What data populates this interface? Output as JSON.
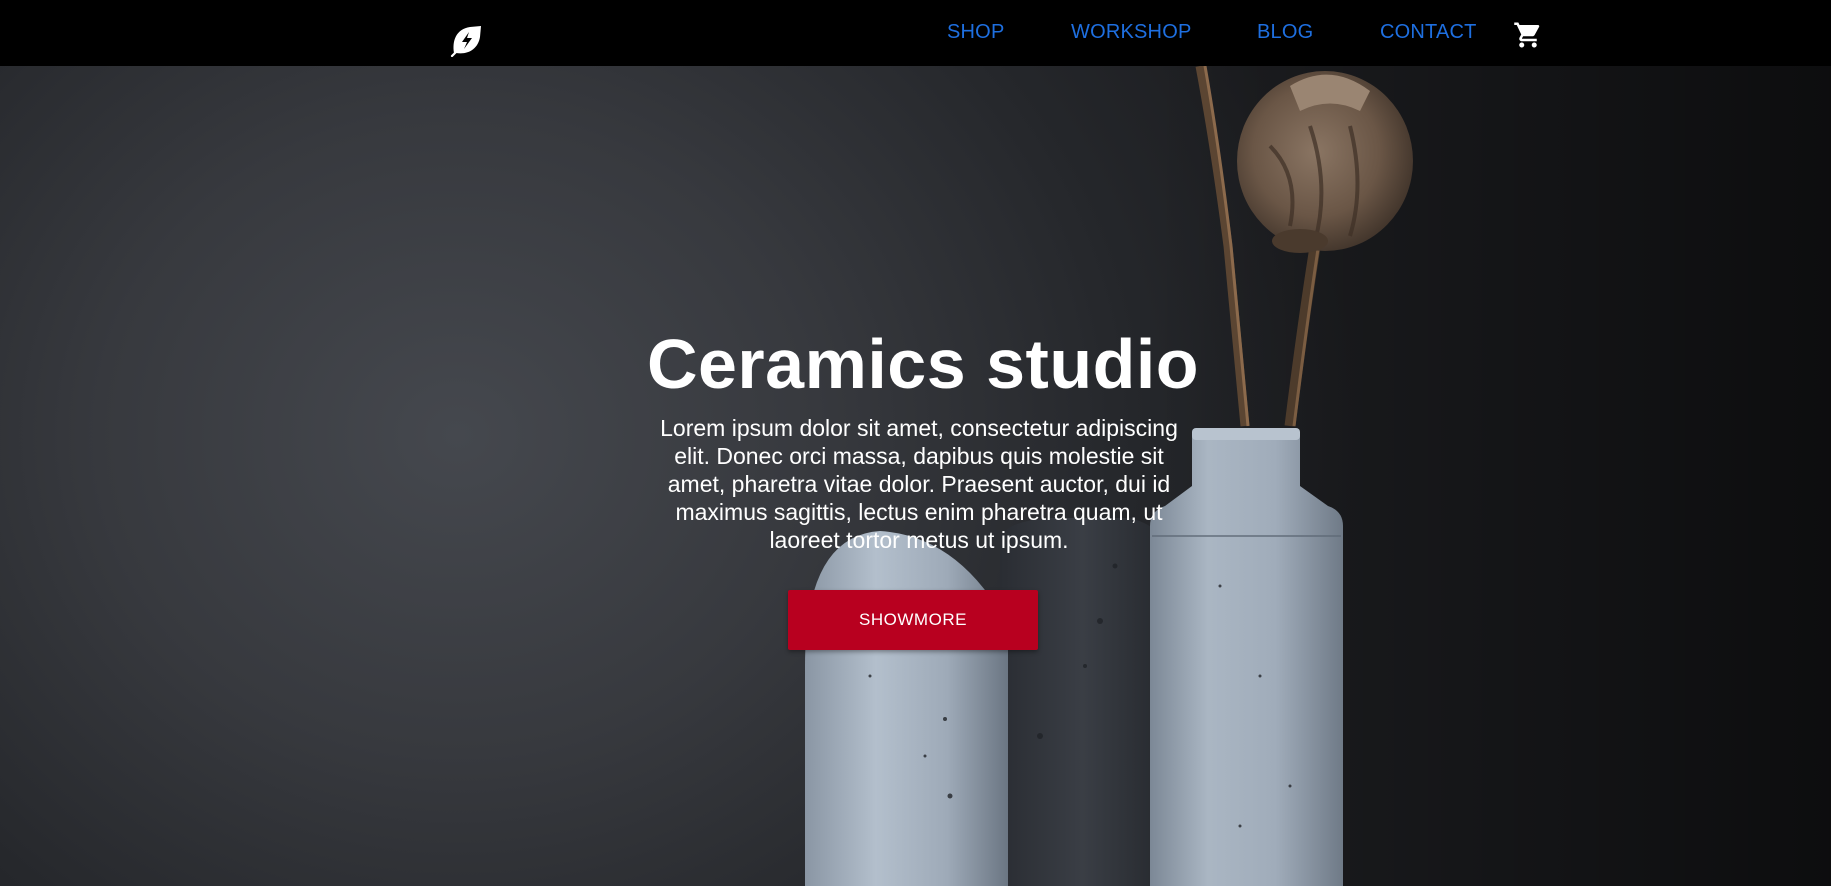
{
  "nav": {
    "logo_icon": "leaf-bolt-icon",
    "links": [
      {
        "label": "SHOP"
      },
      {
        "label": "WORKSHOP"
      },
      {
        "label": "BLOG"
      },
      {
        "label": "CONTACT"
      }
    ],
    "cart_icon": "shopping-cart-icon",
    "link_color": "#1e6fe0",
    "background": "#000000"
  },
  "hero": {
    "title": "Ceramics studio",
    "text": "Lorem ipsum dolor sit amet, consectetur adipiscing elit. Donec orci massa, dapibus quis molestie sit amet, pharetra vitae dolor. Praesent auctor, dui id maximus sagittis, lectus enim pharetra quam, ut laoreet tortor metus ut ipsum.",
    "button_label": "SHOWMORE",
    "button_color": "#b8001f"
  }
}
